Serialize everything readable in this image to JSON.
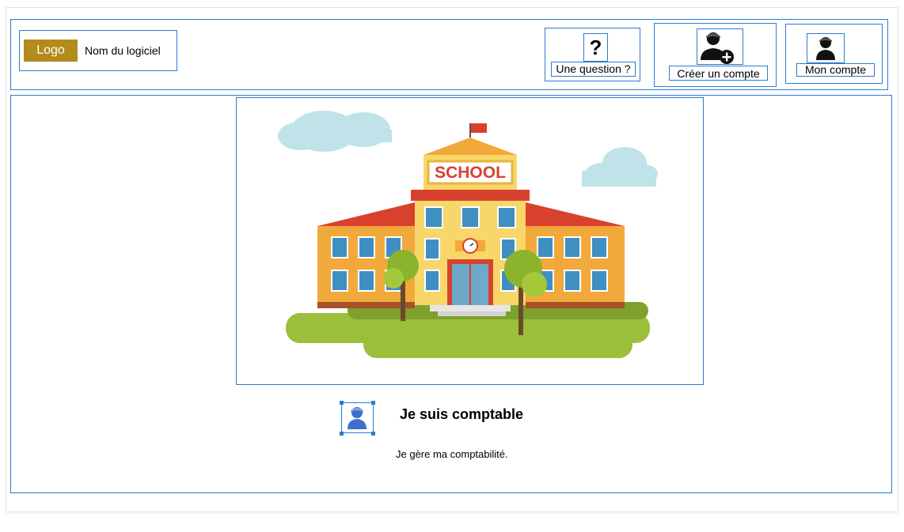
{
  "header": {
    "logo_text": "Logo",
    "app_name": "Nom du logiciel",
    "help": {
      "icon": "question-mark-icon",
      "label": "Une question ?"
    },
    "create_account": {
      "icon": "user-plus-icon",
      "label": "Créer un compte"
    },
    "my_account": {
      "icon": "user-icon",
      "label": "Mon compte"
    }
  },
  "hero": {
    "image": "school-building-illustration",
    "sign_text": "SCHOOL"
  },
  "persona": {
    "icon": "user-avatar-icon",
    "title": "Je suis comptable",
    "description": "Je gère ma comptabilité."
  },
  "colors": {
    "border_accent": "#2b7bd0",
    "logo_badge": "#b38a1c",
    "persona_icon": "#3d6fcf"
  }
}
